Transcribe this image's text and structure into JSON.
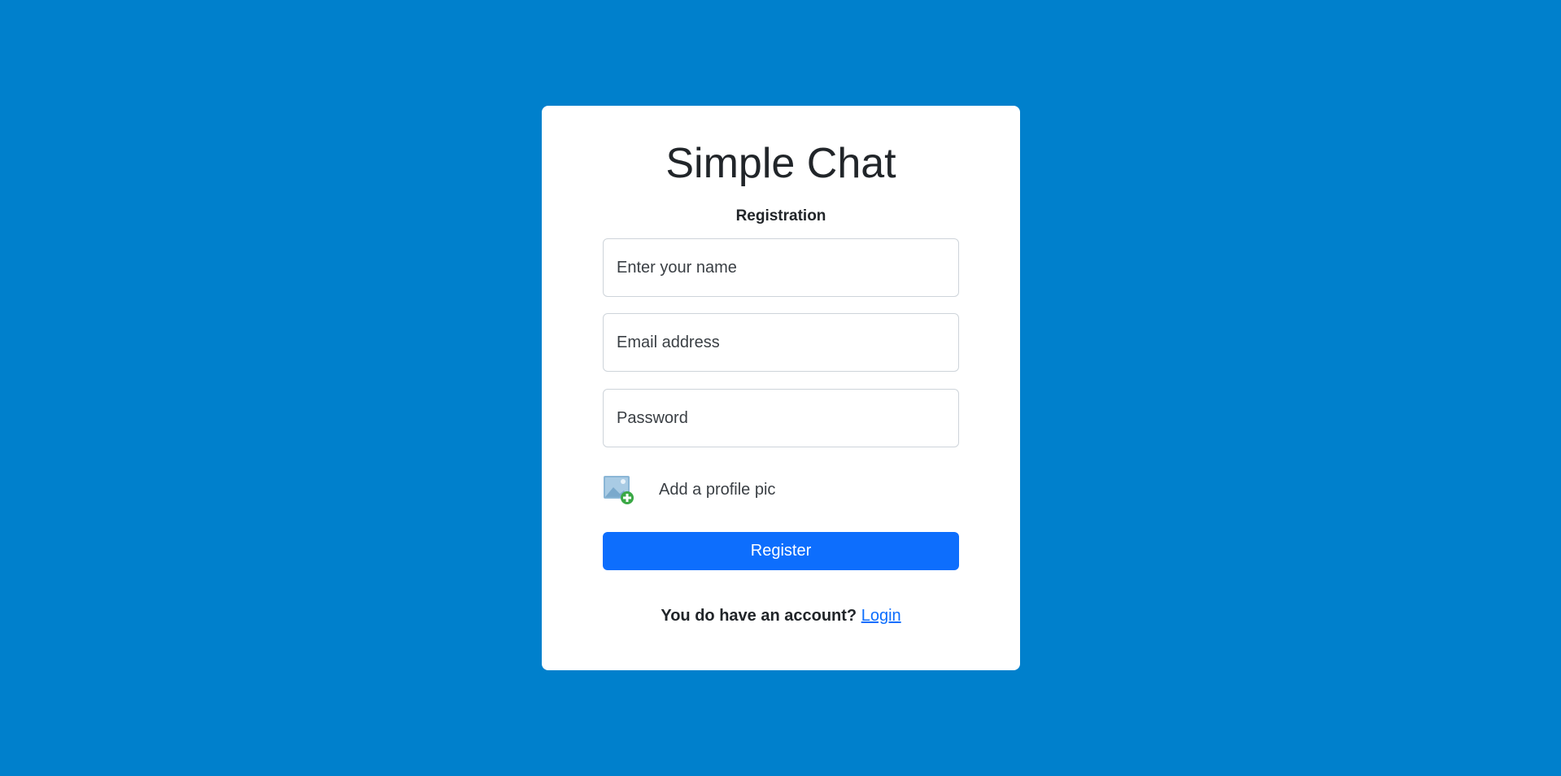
{
  "app": {
    "title": "Simple Chat",
    "subtitle": "Registration"
  },
  "form": {
    "name_placeholder": "Enter your name",
    "email_placeholder": "Email address",
    "password_placeholder": "Password",
    "profile_pic_label": "Add a profile pic",
    "profile_pic_icon": "add-image-icon",
    "register_label": "Register"
  },
  "footer": {
    "prompt": "You do have an account?",
    "login_label": "Login"
  },
  "colors": {
    "background": "#0080cc",
    "card": "#ffffff",
    "primary": "#0d6efd",
    "text": "#212529"
  }
}
